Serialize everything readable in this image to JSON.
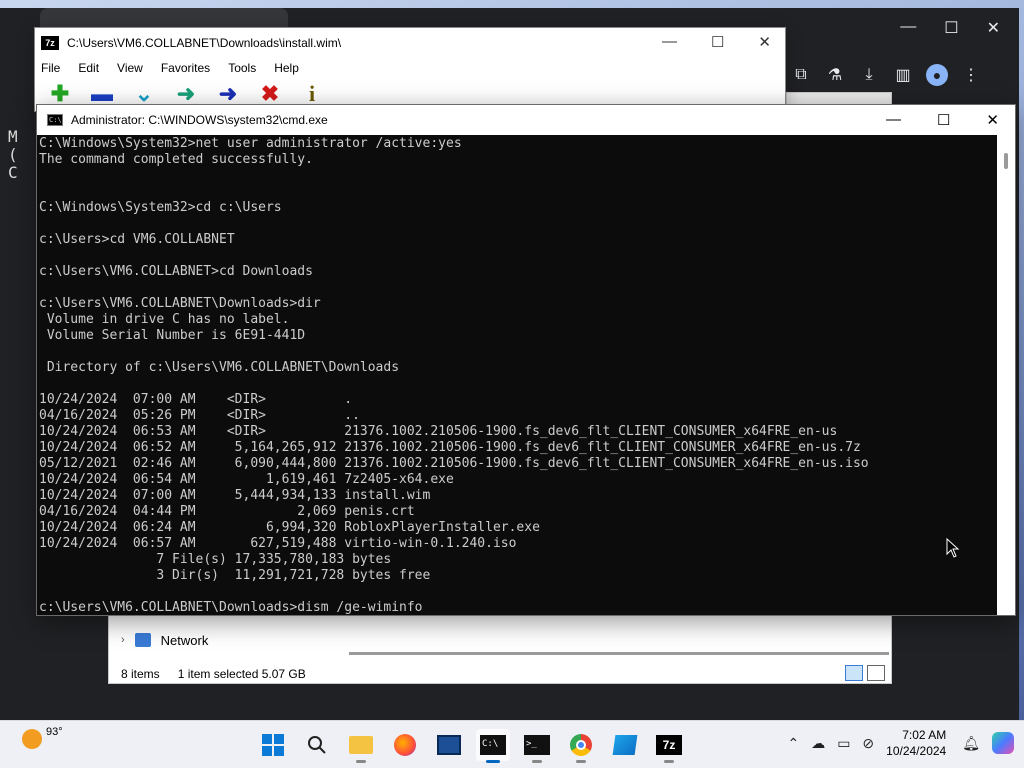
{
  "chrome": {
    "toolbar_icons": [
      "extensions-icon",
      "labs-icon",
      "download-icon",
      "sidebar-icon",
      "profile-icon",
      "menu-icon"
    ],
    "side_text": [
      "M",
      "(",
      "",
      "C"
    ]
  },
  "sevenzip": {
    "title": "C:\\Users\\VM6.COLLABNET\\Downloads\\install.wim\\",
    "logo": "7z",
    "menu": [
      "File",
      "Edit",
      "View",
      "Favorites",
      "Tools",
      "Help"
    ],
    "tools": [
      {
        "name": "add-icon",
        "glyph": "+",
        "color": "#22a822"
      },
      {
        "name": "extract-icon",
        "glyph": "▬",
        "color": "#1a3fc4"
      },
      {
        "name": "test-icon",
        "glyph": "✓",
        "color": "#1aa0c8"
      },
      {
        "name": "copy-icon",
        "glyph": "➜",
        "color": "#1aa07a"
      },
      {
        "name": "move-icon",
        "glyph": "➜",
        "color": "#1a2fb4"
      },
      {
        "name": "delete-icon",
        "glyph": "✖",
        "color": "#d41a1a"
      },
      {
        "name": "info-icon",
        "glyph": "i",
        "color": "#6a5a00"
      }
    ]
  },
  "cmd": {
    "title": "Administrator: C:\\WINDOWS\\system32\\cmd.exe",
    "lines": [
      "C:\\Windows\\System32>net user administrator /active:yes",
      "The command completed successfully.",
      "",
      "",
      "C:\\Windows\\System32>cd c:\\Users",
      "",
      "c:\\Users>cd VM6.COLLABNET",
      "",
      "c:\\Users\\VM6.COLLABNET>cd Downloads",
      "",
      "c:\\Users\\VM6.COLLABNET\\Downloads>dir",
      " Volume in drive C has no label.",
      " Volume Serial Number is 6E91-441D",
      "",
      " Directory of c:\\Users\\VM6.COLLABNET\\Downloads",
      "",
      "10/24/2024  07:00 AM    <DIR>          .",
      "04/16/2024  05:26 PM    <DIR>          ..",
      "10/24/2024  06:53 AM    <DIR>          21376.1002.210506-1900.fs_dev6_flt_CLIENT_CONSUMER_x64FRE_en-us",
      "10/24/2024  06:52 AM     5,164,265,912 21376.1002.210506-1900.fs_dev6_flt_CLIENT_CONSUMER_x64FRE_en-us.7z",
      "05/12/2021  02:46 AM     6,090,444,800 21376.1002.210506-1900.fs_dev6_flt_CLIENT_CONSUMER_x64FRE_en-us.iso",
      "10/24/2024  06:54 AM         1,619,461 7z2405-x64.exe",
      "10/24/2024  07:00 AM     5,444,934,133 install.wim",
      "04/16/2024  04:44 PM             2,069 penis.crt",
      "10/24/2024  06:24 AM         6,994,320 RobloxPlayerInstaller.exe",
      "10/24/2024  06:57 AM       627,519,488 virtio-win-0.1.240.iso",
      "               7 File(s) 17,335,780,183 bytes",
      "               3 Dir(s)  11,291,721,728 bytes free",
      "",
      "c:\\Users\\VM6.COLLABNET\\Downloads>dism /ge-wiminfo"
    ]
  },
  "explorer": {
    "nav_item": "Network",
    "items_count": "8 items",
    "selection": "1 item selected  5.07 GB"
  },
  "taskbar": {
    "temperature": "93°",
    "apps": [
      {
        "name": "start-button",
        "icon": "windows-logo-icon",
        "active": false
      },
      {
        "name": "search-button",
        "icon": "search-icon",
        "active": false
      },
      {
        "name": "file-explorer-button",
        "icon": "folder-icon",
        "active": false
      },
      {
        "name": "firefox-button",
        "icon": "firefox-icon",
        "active": false
      },
      {
        "name": "task-manager-button",
        "icon": "monitor-icon",
        "active": false
      },
      {
        "name": "cmd-button",
        "icon": "terminal-icon",
        "active": true
      },
      {
        "name": "terminal-button",
        "icon": "terminal-icon",
        "active": false
      },
      {
        "name": "chrome-button",
        "icon": "chrome-icon",
        "active": false
      },
      {
        "name": "flag-app-button",
        "icon": "flag-icon",
        "active": false
      },
      {
        "name": "sevenzip-button",
        "icon": "sevenzip-icon",
        "active": false
      }
    ],
    "time": "7:02 AM",
    "date": "10/24/2024"
  }
}
